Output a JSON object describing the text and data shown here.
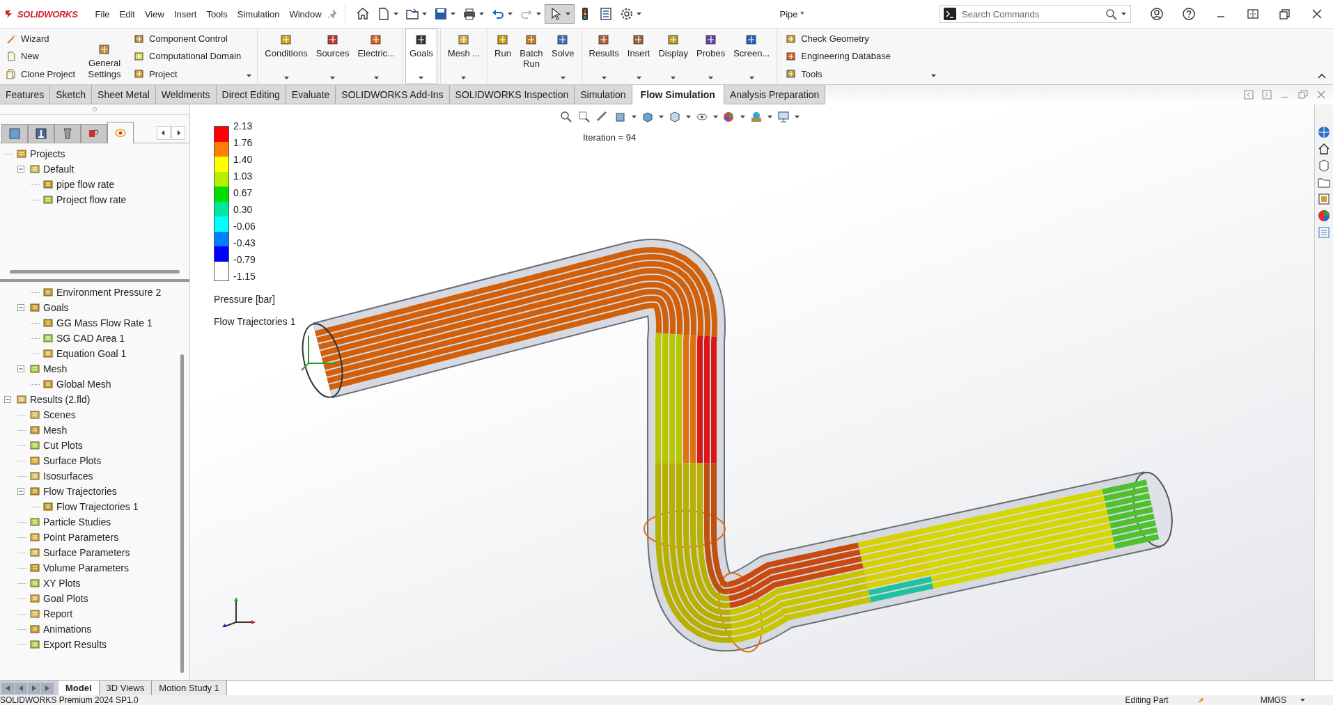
{
  "app": {
    "name": "SOLIDWORKS"
  },
  "menu": [
    "File",
    "Edit",
    "View",
    "Insert",
    "Tools",
    "Simulation",
    "Window"
  ],
  "document_title": "Pipe *",
  "search": {
    "placeholder": "Search Commands"
  },
  "ribbon": {
    "left_items": [
      "Wizard",
      "New",
      "Clone Project"
    ],
    "general_settings": "General Settings",
    "middle_items": [
      "Component Control",
      "Computational Domain",
      "Project"
    ],
    "buttons": [
      {
        "label": "Conditions",
        "pressed": false,
        "dropdown": true
      },
      {
        "label": "Sources",
        "pressed": false,
        "dropdown": true
      },
      {
        "label": "Electric...",
        "pressed": false,
        "dropdown": true
      },
      {
        "label": "Goals",
        "pressed": true,
        "dropdown": true
      },
      {
        "label": "Mesh ...",
        "pressed": false,
        "dropdown": true
      },
      {
        "label": "Run",
        "pressed": false,
        "dropdown": false
      },
      {
        "label": "Batch Run",
        "pressed": false,
        "dropdown": false
      },
      {
        "label": "Solve",
        "pressed": false,
        "dropdown": true
      },
      {
        "label": "Results",
        "pressed": false,
        "dropdown": true
      },
      {
        "label": "Insert",
        "pressed": false,
        "dropdown": true
      },
      {
        "label": "Display",
        "pressed": false,
        "dropdown": true
      },
      {
        "label": "Probes",
        "pressed": false,
        "dropdown": true
      },
      {
        "label": "Screen...",
        "pressed": false,
        "dropdown": true
      }
    ],
    "right_items": [
      "Check Geometry",
      "Engineering Database",
      "Tools"
    ]
  },
  "command_tabs": [
    {
      "label": "Features",
      "selected": false
    },
    {
      "label": "Sketch",
      "selected": false
    },
    {
      "label": "Sheet Metal",
      "selected": false
    },
    {
      "label": "Weldments",
      "selected": false
    },
    {
      "label": "Direct Editing",
      "selected": false
    },
    {
      "label": "Evaluate",
      "selected": false
    },
    {
      "label": "SOLIDWORKS Add-Ins",
      "selected": false
    },
    {
      "label": "SOLIDWORKS Inspection",
      "selected": false
    },
    {
      "label": "Simulation",
      "selected": false
    },
    {
      "label": "Flow Simulation",
      "selected": true
    },
    {
      "label": "Analysis Preparation",
      "selected": false
    }
  ],
  "panel_tabs": [
    {
      "selected": false
    },
    {
      "selected": false
    },
    {
      "selected": false
    },
    {
      "selected": false
    },
    {
      "selected": true
    }
  ],
  "projects_tree": [
    {
      "label": "Projects",
      "children": [
        {
          "label": "Default",
          "expanded": true,
          "children": [
            {
              "label": "pipe flow rate"
            },
            {
              "label": "Project flow rate"
            }
          ]
        }
      ]
    }
  ],
  "analysis_tree": [
    {
      "children": [
        {
          "children": [
            {
              "label": "Environment Pressure 2"
            }
          ]
        },
        {
          "label": "Goals",
          "expanded": true,
          "children": [
            {
              "label": "GG Mass Flow Rate 1"
            },
            {
              "label": "SG CAD Area 1"
            },
            {
              "label": "Equation Goal 1"
            }
          ]
        },
        {
          "label": "Mesh",
          "expanded": true,
          "children": [
            {
              "label": "Global Mesh"
            }
          ]
        }
      ]
    },
    {
      "label": "Results (2.fld)",
      "expanded": true,
      "children": [
        {
          "label": "Scenes"
        },
        {
          "label": "Mesh"
        },
        {
          "label": "Cut Plots"
        },
        {
          "label": "Surface Plots"
        },
        {
          "label": "Isosurfaces"
        },
        {
          "label": "Flow Trajectories",
          "expanded": true,
          "children": [
            {
              "label": "Flow Trajectories 1"
            }
          ]
        },
        {
          "label": "Particle Studies"
        },
        {
          "label": "Point Parameters"
        },
        {
          "label": "Surface Parameters"
        },
        {
          "label": "Volume Parameters"
        },
        {
          "label": "XY Plots"
        },
        {
          "label": "Goal Plots"
        },
        {
          "label": "Report"
        },
        {
          "label": "Animations"
        },
        {
          "label": "Export Results"
        }
      ]
    }
  ],
  "viewport": {
    "iteration": "Iteration = 94",
    "legend": {
      "title": "Pressure [bar]",
      "ticks": [
        "2.13",
        "1.76",
        "1.40",
        "1.03",
        "0.67",
        "0.30",
        "-0.06",
        "-0.43",
        "-0.79",
        "-1.15"
      ],
      "bands": [
        {
          "color": "#ff0000"
        },
        {
          "color": "#ff7f00"
        },
        {
          "color": "#ffff00"
        },
        {
          "color": "#b4f000"
        },
        {
          "color": "#00e000"
        },
        {
          "color": "#00e8a0"
        },
        {
          "color": "#00ffff"
        },
        {
          "color": "#0080ff"
        },
        {
          "color": "#0000ff"
        }
      ]
    },
    "plot_label": "Flow Trajectories 1"
  },
  "bottom_tabs": [
    {
      "label": "Model",
      "selected": true
    },
    {
      "label": "3D Views",
      "selected": false
    },
    {
      "label": "Motion Study 1",
      "selected": false
    }
  ],
  "status": {
    "product": "SOLIDWORKS Premium 2024 SP1.0",
    "mode": "Editing Part",
    "units": "MMGS"
  }
}
